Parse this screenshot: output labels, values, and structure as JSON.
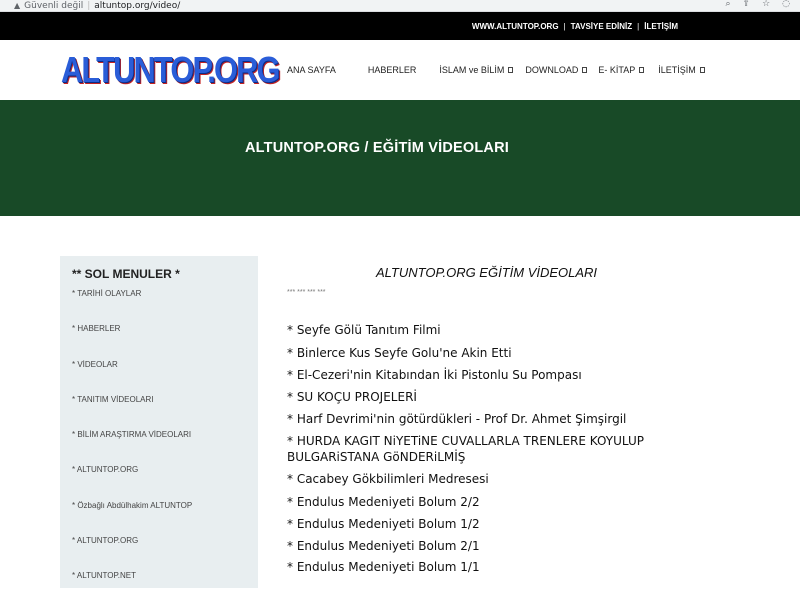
{
  "browser": {
    "security": "Güvenli değil",
    "url": "altuntop.org/video/"
  },
  "top_bar": {
    "links": [
      "WWW.ALTUNTOP.ORG",
      "TAVSİYE EDİNİZ",
      "İLETİŞİM"
    ],
    "separator": "|"
  },
  "header": {
    "logo_text": "ALTUNTOP.ORG",
    "menu": [
      {
        "label": "ANA SAYFA",
        "dropdown": false
      },
      {
        "label": "HABERLER",
        "dropdown": false
      },
      {
        "label": "İSLAM ve BİLİM",
        "dropdown": true
      },
      {
        "label": "DOWNLOAD",
        "dropdown": true
      },
      {
        "label": "E- KİTAP",
        "dropdown": true
      },
      {
        "label": "İLETİŞİM",
        "dropdown": true
      }
    ]
  },
  "banner": {
    "title": "ALTUNTOP.ORG / EĞİTİM VİDEOLARI"
  },
  "sidebar": {
    "title": "** SOL MENULER *",
    "items": [
      "* TARİHİ OLAYLAR",
      "* HABERLER",
      "* VİDEOLAR",
      "* TANITIM VİDEOLARI",
      "* BİLİM ARAŞTIRMA VİDEOLARI",
      "* ALTUNTOP.ORG",
      "* Özbağlı Abdülhakim ALTUNTOP",
      "* ALTUNTOP.ORG",
      "* ALTUNTOP.NET"
    ]
  },
  "main": {
    "title": "ALTUNTOP.ORG EĞİTİM VİDEOLARI",
    "dots": "*** *** *** ***",
    "videos": [
      "* Seyfe Gölü Tanıtım Filmi",
      "* Binlerce Kus Seyfe Golu'ne Akin Etti",
      "* El-Cezeri'nin Kitabından İki Pistonlu Su Pompası",
      "* SU KOÇU PROJELERİ",
      "* Harf Devrimi'nin götürdükleri - Prof Dr. Ahmet Şimşirgil",
      "* HURDA KAGIT NiYETiNE CUVALLARLA TRENLERE KOYULUP BULGARiSTANA GöNDERiLMİŞ",
      "* Cacabey Gökbilimleri Medresesi",
      "* Endulus Medeniyeti Bolum 2/2",
      "* Endulus Medeniyeti Bolum 1/2",
      "* Endulus Medeniyeti Bolum 2/1",
      "* Endulus Medeniyeti Bolum 1/1"
    ]
  }
}
